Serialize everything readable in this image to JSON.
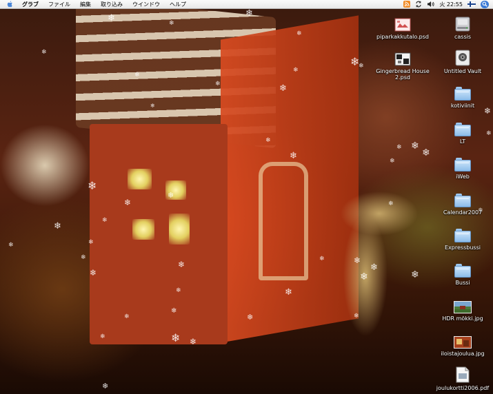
{
  "menubar": {
    "app_name": "グラブ",
    "menus": [
      "ファイル",
      "編集",
      "取り込み",
      "ウインドウ",
      "ヘルプ"
    ],
    "clock": "火 22:55",
    "status_icons": [
      "rss-icon",
      "sync-icon",
      "volume-icon",
      "flag-fi-icon",
      "spotlight-icon"
    ]
  },
  "desktop": {
    "icons": [
      {
        "label": "piparkakkutalo.psd",
        "kind": "psd-file-icon"
      },
      {
        "label": "cassis",
        "kind": "hard-drive-icon"
      },
      {
        "label": "Gingerbread House\n2.psd",
        "kind": "psd-file-icon"
      },
      {
        "label": "Untitled Vault",
        "kind": "vault-icon"
      },
      {
        "label": "kotiviinit",
        "kind": "folder-icon"
      },
      {
        "label": "LT",
        "kind": "folder-icon"
      },
      {
        "label": "iWeb",
        "kind": "folder-icon"
      },
      {
        "label": "Calendar2007",
        "kind": "folder-icon"
      },
      {
        "label": "Expressbussi",
        "kind": "folder-icon"
      },
      {
        "label": "Bussi",
        "kind": "folder-icon"
      },
      {
        "label": "HDR mökki.jpg",
        "kind": "jpg-file-icon"
      },
      {
        "label": "iloistajoulua.jpg",
        "kind": "jpg-file-icon"
      },
      {
        "label": "joulukortti2006.pdf",
        "kind": "pdf-file-icon"
      }
    ]
  },
  "colors": {
    "menubar": "#f0f0f0",
    "folder": "#8cbce9",
    "spotlight": "#3d7bd6",
    "wallpaper_red": "#d84a20"
  }
}
